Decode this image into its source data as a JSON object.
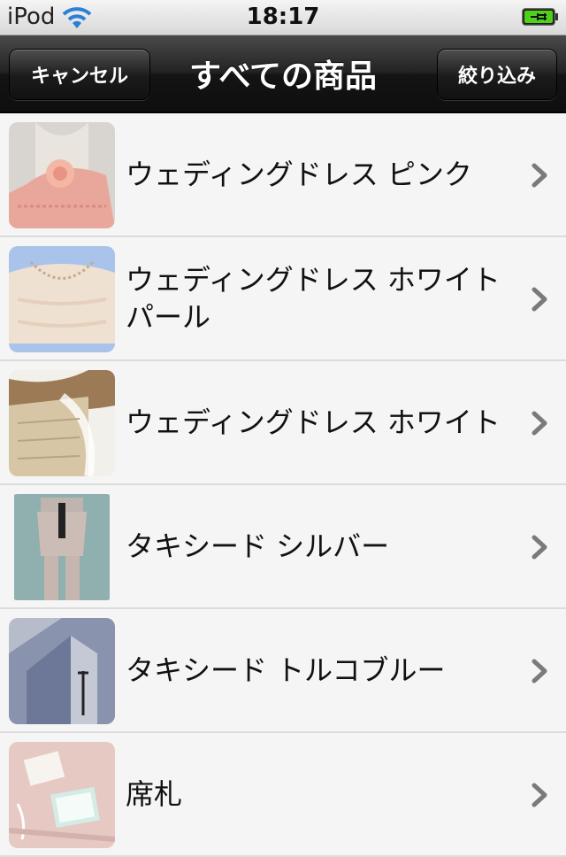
{
  "status_bar": {
    "carrier": "iPod",
    "time": "18:17",
    "icons": [
      "wifi-icon",
      "battery-charging-icon"
    ]
  },
  "nav": {
    "cancel_label": "キャンセル",
    "title": "すべての商品",
    "filter_label": "絞り込み"
  },
  "products": [
    {
      "name": "ウェディングドレス ピンク",
      "thumb": "pink-dress-thumbnail"
    },
    {
      "name": "ウェディングドレス ホワイトパール",
      "thumb": "white-pearl-dress-thumbnail"
    },
    {
      "name": "ウェディングドレス ホワイト",
      "thumb": "white-dress-thumbnail"
    },
    {
      "name": "タキシード シルバー",
      "thumb": "silver-tuxedo-thumbnail"
    },
    {
      "name": "タキシード トルコブルー",
      "thumb": "turquoise-tuxedo-thumbnail"
    },
    {
      "name": "席札",
      "thumb": "place-card-thumbnail"
    }
  ],
  "colors": {
    "navbar": "#1a1a1a",
    "list_background": "#f5f5f5",
    "separator": "#dcdcdc",
    "chevron": "#7a7a7a"
  }
}
